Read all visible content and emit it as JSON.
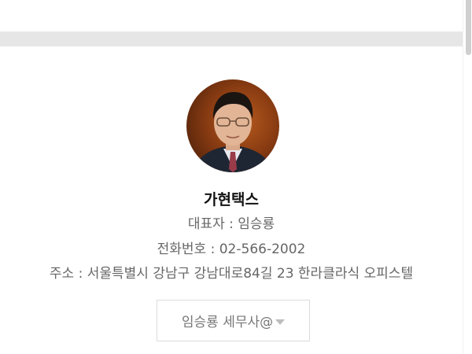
{
  "profile": {
    "name": "가현택스",
    "representative": "대표자 : 임승룡",
    "phone": "전화번호 : 02-566-2002",
    "address": "주소 : 서울특별시 강남구 강남대로84길 23 한라클라식 오피스텔"
  },
  "dropdown": {
    "selected": "임승룡 세무사@",
    "caret_icon": "caret-down-icon"
  },
  "avatar": {
    "icon": "profile-photo"
  },
  "colors": {
    "band": "#e6e6e6",
    "name_text": "#111111",
    "info_text": "#666666",
    "dropdown_border": "#dcdcdc",
    "avatar_bg": "#8a3c12"
  }
}
